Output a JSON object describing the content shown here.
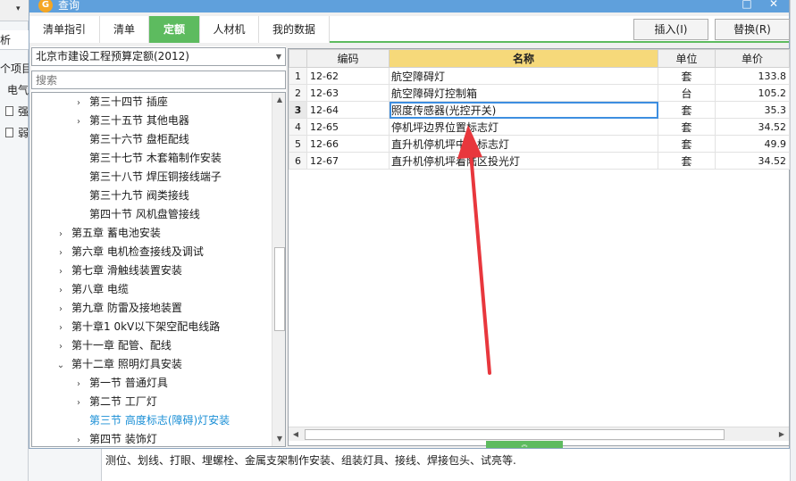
{
  "dialog": {
    "title": "查询",
    "tabs": [
      {
        "label": "清单指引"
      },
      {
        "label": "清单"
      },
      {
        "label": "定额"
      },
      {
        "label": "人材机"
      },
      {
        "label": "我的数据"
      }
    ],
    "active_tab": "定额",
    "insert_button": "插入(I)",
    "replace_button": "替换(R)"
  },
  "background": {
    "tab_label": "析",
    "row1_text": "个项目",
    "row2_text": "电气",
    "row3_text": "强",
    "row4_text": "弱",
    "description": "测位、划线、打眼、埋螺栓、金属支架制作安装、组装灯具、接线、焊接包头、试亮等."
  },
  "left_panel": {
    "library": "北京市建设工程预算定额(2012)",
    "search_placeholder": "搜索",
    "tree": [
      {
        "label": "第三十四节 插座",
        "level": 2,
        "toggle": "›"
      },
      {
        "label": "第三十五节 其他电器",
        "level": 2,
        "toggle": "›"
      },
      {
        "label": "第三十六节 盘柜配线",
        "level": 2,
        "toggle": ""
      },
      {
        "label": "第三十七节 木套箱制作安装",
        "level": 2,
        "toggle": ""
      },
      {
        "label": "第三十八节 焊压铜接线端子",
        "level": 2,
        "toggle": ""
      },
      {
        "label": "第三十九节 阀类接线",
        "level": 2,
        "toggle": ""
      },
      {
        "label": "第四十节 风机盘管接线",
        "level": 2,
        "toggle": ""
      },
      {
        "label": "第五章 蓄电池安装",
        "level": 1,
        "toggle": "›"
      },
      {
        "label": "第六章 电机检查接线及调试",
        "level": 1,
        "toggle": "›"
      },
      {
        "label": "第七章 滑触线装置安装",
        "level": 1,
        "toggle": "›"
      },
      {
        "label": "第八章 电缆",
        "level": 1,
        "toggle": "›"
      },
      {
        "label": "第九章 防雷及接地装置",
        "level": 1,
        "toggle": "›"
      },
      {
        "label": "第十章1 0kV以下架空配电线路",
        "level": 1,
        "toggle": "›"
      },
      {
        "label": "第十一章 配管、配线",
        "level": 1,
        "toggle": "›"
      },
      {
        "label": "第十二章 照明灯具安装",
        "level": 1,
        "toggle": "⌄"
      },
      {
        "label": "第一节 普通灯具",
        "level": 2,
        "toggle": "›"
      },
      {
        "label": "第二节 工厂灯",
        "level": 2,
        "toggle": "›"
      },
      {
        "label": "第三节 高度标志(障碍)灯安装",
        "level": 2,
        "toggle": "",
        "selected": true
      },
      {
        "label": "第四节 装饰灯",
        "level": 2,
        "toggle": "›"
      }
    ]
  },
  "grid": {
    "columns": {
      "num": "",
      "code": "编码",
      "name": "名称",
      "unit": "单位",
      "price": "单价"
    },
    "rows": [
      {
        "num": "1",
        "code": "12-62",
        "name": "航空障碍灯",
        "unit": "套",
        "price": "133.8"
      },
      {
        "num": "2",
        "code": "12-63",
        "name": "航空障碍灯控制箱",
        "unit": "台",
        "price": "105.2"
      },
      {
        "num": "3",
        "code": "12-64",
        "name": "照度传感器(光控开关)",
        "unit": "套",
        "price": "35.3"
      },
      {
        "num": "4",
        "code": "12-65",
        "name": "停机坪边界位置标志灯",
        "unit": "套",
        "price": "34.52"
      },
      {
        "num": "5",
        "code": "12-66",
        "name": "直升机停机坪中心标志灯",
        "unit": "套",
        "price": "49.9"
      },
      {
        "num": "6",
        "code": "12-67",
        "name": "直升机停机坪着陆区投光灯",
        "unit": "套",
        "price": "34.52"
      }
    ],
    "current_row": 3
  },
  "colors": {
    "accent_green": "#5dbb5f",
    "title_blue": "#5fa0dc",
    "annotation_red": "#e8373d",
    "sorted_header": "#f6d97a"
  }
}
